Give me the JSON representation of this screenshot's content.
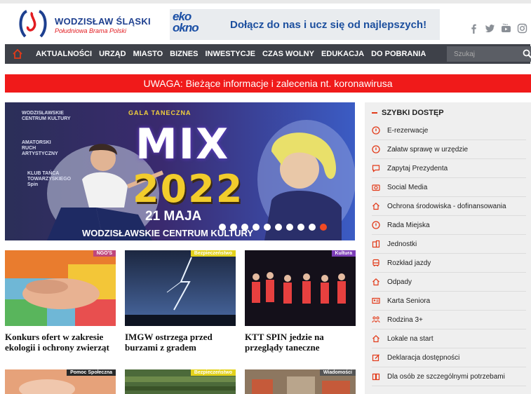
{
  "header": {
    "logo_name": "WODZISŁAW ŚLĄSKI",
    "logo_tagline": "Południowa Brama Polski",
    "banner_brand_1": "eko",
    "banner_brand_2": "okno",
    "banner_text": "Dołącz do nas i ucz się od najlepszych!",
    "socials": [
      "facebook-icon",
      "twitter-icon",
      "youtube-icon",
      "instagram-icon"
    ]
  },
  "nav": {
    "items": [
      "AKTUALNOŚCI",
      "URZĄD",
      "MIASTO",
      "BIZNES",
      "INWESTYCJE",
      "CZAS WOLNY",
      "EDUKACJA",
      "DO POBRANIA"
    ],
    "search_placeholder": "Szukaj"
  },
  "alert": {
    "text": "UWAGA: Bieżące informacje i zalecenia nt. koronawirusa"
  },
  "hero": {
    "logos": [
      "WODZISŁAWSKIE CENTRUM KULTURY",
      "AMATORSKI RUCH ARTYSTYCZNY",
      "KLUB TAŃCA TOWARZYSKIEGO Spin"
    ],
    "title": "GALA TANECZNA",
    "big_word": "MIX",
    "year": "2022",
    "date": "21 MAJA",
    "venue": "WODZISŁAWSKIE CENTRUM KULTURY",
    "slide_count": 10,
    "active_slide": 10
  },
  "cards": [
    {
      "tag": "NGO'S",
      "title": "Konkurs ofert w zakresie ekologii i ochrony zwierząt",
      "tag_color": "#c0467b"
    },
    {
      "tag": "Bezpieczeństwo",
      "title": "IMGW ostrzega przed burzami z gradem",
      "tag_color": "#e3d21c"
    },
    {
      "tag": "Kultura",
      "title": "KTT SPIN jedzie na przeglądy taneczne",
      "tag_color": "#7d3fb8"
    },
    {
      "tag": "Pomoc Społeczna",
      "title": "",
      "tag_color": "#2a2a2a"
    },
    {
      "tag": "Bezpieczeństwo",
      "title": "",
      "tag_color": "#e3d21c"
    },
    {
      "tag": "Wiadomości",
      "title": "",
      "tag_color": "#555555"
    }
  ],
  "sidebar": {
    "title": "SZYBKI DOSTĘP",
    "items": [
      {
        "label": "E-rezerwacje",
        "icon": "info-circle-icon"
      },
      {
        "label": "Załatw sprawę w urzędzie",
        "icon": "info-circle-icon"
      },
      {
        "label": "Zapytaj Prezydenta",
        "icon": "chat-icon"
      },
      {
        "label": "Social Media",
        "icon": "camera-icon"
      },
      {
        "label": "Ochrona środowiska - dofinansowania",
        "icon": "home-icon"
      },
      {
        "label": "Rada Miejska",
        "icon": "info-circle-icon"
      },
      {
        "label": "Jednostki",
        "icon": "building-icon"
      },
      {
        "label": "Rozkład jazdy",
        "icon": "bus-icon"
      },
      {
        "label": "Odpady",
        "icon": "home-icon"
      },
      {
        "label": "Karta Seniora",
        "icon": "id-card-icon"
      },
      {
        "label": "Rodzina 3+",
        "icon": "family-icon"
      },
      {
        "label": "Lokale na start",
        "icon": "home-icon"
      },
      {
        "label": "Deklaracja dostępności",
        "icon": "edit-icon"
      },
      {
        "label": "Dla osób ze szczególnymi potrzebami",
        "icon": "book-icon"
      }
    ]
  },
  "colors": {
    "accent": "#e23a19",
    "nav_bg": "#3e4149",
    "alert_bg": "#f01a1a",
    "brand_blue": "#1d3f8f"
  }
}
